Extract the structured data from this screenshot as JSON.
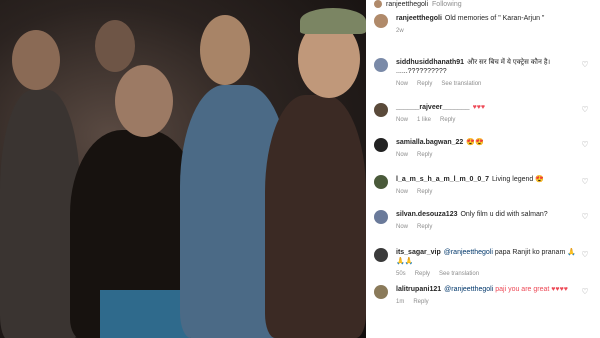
{
  "post": {
    "author": "ranjeetthegoli",
    "follow_label": "Following",
    "caption_user": "ranjeetthegoli",
    "caption_text": "Old memories of \" Karan-Arjun \"",
    "caption_time": "2w"
  },
  "comments": [
    {
      "user": "siddhusiddhanath91",
      "mention": "",
      "text": "और सर बिच में ये एक्ट्रेस कौन है। ......??????????",
      "time": "Now",
      "actions": [
        "Reply",
        "See translation"
      ],
      "avatar_color": "#7a8aa8"
    },
    {
      "user": "______rajveer_______",
      "mention": "",
      "text": "♥♥♥",
      "time": "Now",
      "actions": [
        "1 like",
        "Reply"
      ],
      "avatar_color": "#5a4a3a"
    },
    {
      "user": "samialla.bagwan_22",
      "mention": "",
      "text": "😍😍",
      "time": "Now",
      "actions": [
        "Reply"
      ],
      "avatar_color": "#222222"
    },
    {
      "user": "l_a_m_s_h_a_m_l_m_0_0_7",
      "mention": "",
      "text": "Living legend 😍",
      "time": "Now",
      "actions": [
        "Reply"
      ],
      "avatar_color": "#4a5a3a"
    },
    {
      "user": "silvan.desouza123",
      "mention": "",
      "text": "Only film u did with salman?",
      "time": "Now",
      "actions": [
        "Reply"
      ],
      "avatar_color": "#6a7a9a"
    },
    {
      "user": "its_sagar_vip",
      "mention": "@ranjeetthegoli",
      "text": "papa Ranjit ko pranam 🙏🙏🙏",
      "time": "50s",
      "actions": [
        "Reply",
        "See translation"
      ],
      "avatar_color": "#3a3a3a"
    },
    {
      "user": "lalitrupani121",
      "mention": "@ranjeetthegoli",
      "text": "paji you are great ♥♥♥♥",
      "time": "1m",
      "actions": [
        "Reply"
      ],
      "avatar_color": "#8a7a5a"
    }
  ],
  "icons": {
    "heart": "heart-icon"
  },
  "colors": {
    "mention": "#00376b",
    "heart_red": "#ed4956"
  }
}
